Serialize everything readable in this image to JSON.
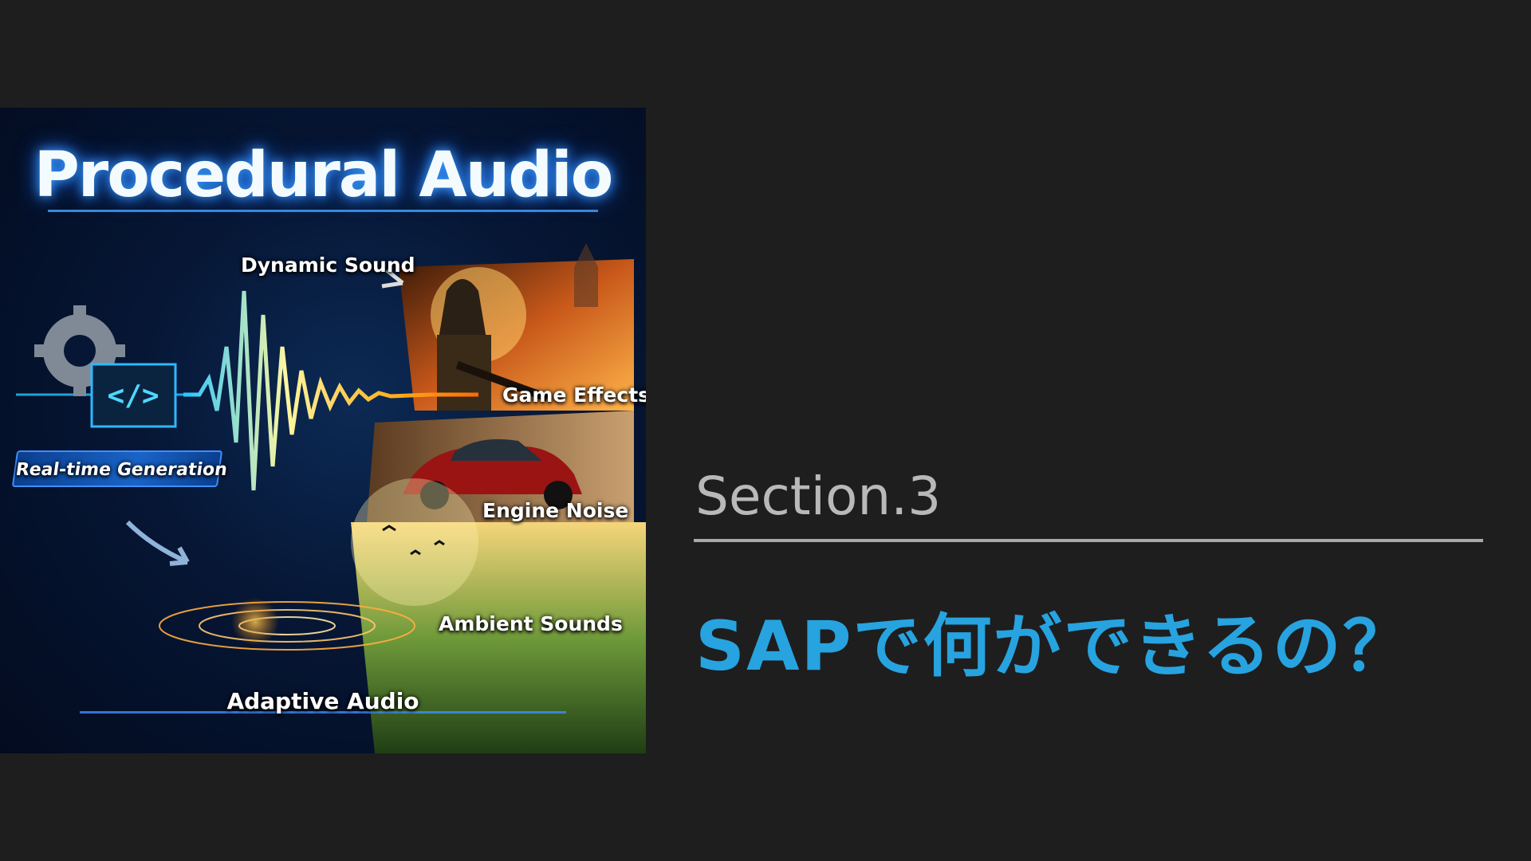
{
  "illustration": {
    "title": "Procedural Audio",
    "labels": {
      "dynamic_sound": "Dynamic Sound",
      "game_effects": "Game Effects",
      "engine_noise": "Engine Noise",
      "ambient_sounds": "Ambient Sounds",
      "adaptive_audio": "Adaptive Audio",
      "realtime_generation": "Real-time Generation"
    },
    "icons": [
      "gear-icon",
      "code-icon",
      "soldier-image",
      "car-image",
      "forest-image",
      "waveform"
    ]
  },
  "section": {
    "label": "Section.3",
    "headline": "SAPで何ができるの？"
  },
  "colors": {
    "background": "#1e1e1e",
    "section_label": "#b9b9b9",
    "divider": "#a9a9a9",
    "headline": "#27a3e0"
  }
}
